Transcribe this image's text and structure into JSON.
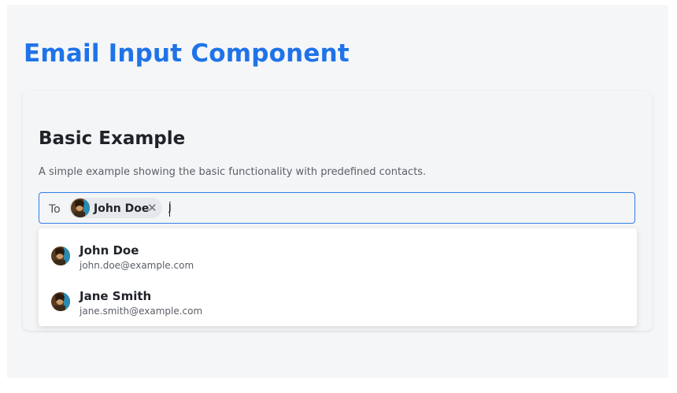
{
  "page": {
    "title": "Email Input Component"
  },
  "basic_example": {
    "title": "Basic Example",
    "description": "A simple example showing the basic functionality with predefined contacts.",
    "field": {
      "label": "To",
      "typed_value": "j",
      "selected": [
        {
          "name": "John Doe",
          "avatar": "avatar-icon"
        }
      ],
      "remove_glyph": "✕"
    },
    "suggestions": [
      {
        "name": "John Doe",
        "email": "john.doe@example.com",
        "avatar": "avatar-icon"
      },
      {
        "name": "Jane Smith",
        "email": "jane.smith@example.com",
        "avatar": "avatar-icon"
      }
    ]
  },
  "colors": {
    "accent": "#1f73e8",
    "focus_border": "#2f7fe6",
    "chip_bg": "#e6e8eb",
    "page_bg": "#f5f6f8"
  }
}
